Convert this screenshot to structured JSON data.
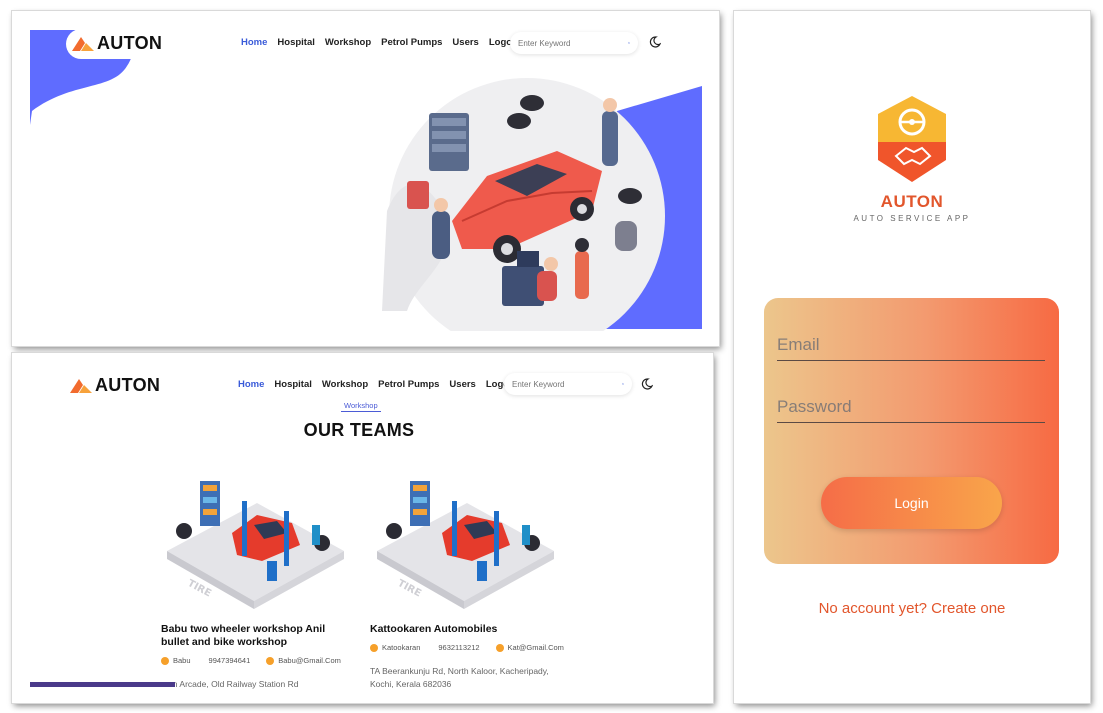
{
  "brand": {
    "name": "AUTON",
    "tagline": "AUTO SERVICE APP",
    "accent": "#f26b2e",
    "blue": "#5f6cff"
  },
  "nav": {
    "items": [
      "Home",
      "Hospital",
      "Workshop",
      "Petrol Pumps",
      "Users",
      "Logout"
    ],
    "active": "Home",
    "search_placeholder": "Enter Keyword"
  },
  "teams": {
    "section_tag": "Workshop",
    "title": "OUR TEAMS",
    "cards": [
      {
        "title": "Babu two wheeler workshop Anil bullet and bike workshop",
        "owner": "Babu",
        "phone": "9947394641",
        "email": "Babu@Gmail.Com",
        "address": "...an Arcade, Old Railway Station Rd"
      },
      {
        "title": "Kattookaren Automobiles",
        "owner": "Katookaran",
        "phone": "9632113212",
        "email": "Kat@Gmail.Com",
        "address": "TA Beerankunju Rd, North Kaloor, Kacheripady, Kochi, Kerala 682036"
      }
    ]
  },
  "login": {
    "email_placeholder": "Email",
    "password_placeholder": "Password",
    "login_label": "Login",
    "signup_text": "No account yet? Create one"
  }
}
